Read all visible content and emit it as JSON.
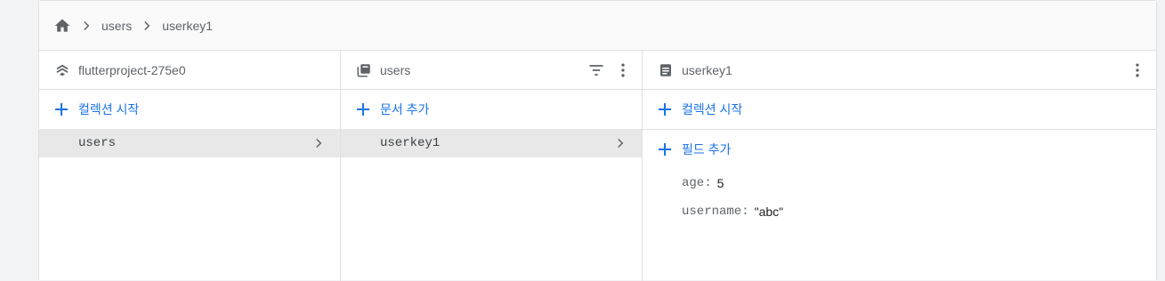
{
  "colors": {
    "accent": "#1a73e8",
    "icon": "#5f6368",
    "selected_row": "#e8e8e8",
    "border": "#e0e0e0"
  },
  "breadcrumb": {
    "home_icon": "home-icon",
    "items": [
      "users",
      "userkey1"
    ]
  },
  "columns": {
    "project": {
      "icon": "firestore-stack-icon",
      "title": "flutterproject-275e0",
      "action_label": "컬렉션 시작",
      "rows": [
        "users"
      ]
    },
    "collection": {
      "icon": "collection-icon",
      "title": "users",
      "tools": [
        "filter-icon",
        "more-vert-icon"
      ],
      "action_label": "문서 추가",
      "rows": [
        "userkey1"
      ]
    },
    "document": {
      "icon": "document-icon",
      "title": "userkey1",
      "tools": [
        "more-vert-icon"
      ],
      "start_collection_label": "컬렉션 시작",
      "add_field_label": "필드 추가",
      "fields": [
        {
          "key": "age",
          "value": "5"
        },
        {
          "key": "username",
          "value": "\"abc\""
        }
      ]
    }
  }
}
